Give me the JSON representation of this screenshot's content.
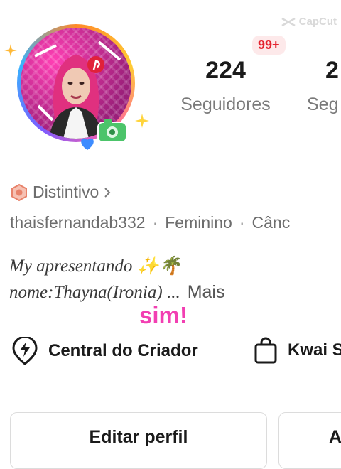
{
  "watermark": {
    "label": "CapCut"
  },
  "profile": {
    "notification_badge": "99+",
    "stats": [
      {
        "number": "224",
        "label": "Seguidores"
      },
      {
        "number": "2",
        "label": "Seg"
      }
    ],
    "badge_label": "Distintivo",
    "username": "thaisfernandab332",
    "gender": "Feminino",
    "extra": "Cânc",
    "separator": "·",
    "bio_line1": "My apresentando ✨🌴",
    "bio_line2": "nome:Thayna(Ironia) ...",
    "bio_more": "Mais",
    "overlay_text": "sim!"
  },
  "actions": {
    "creator_center": "Central do Criador",
    "kwai_shop": "Kwai S"
  },
  "buttons": {
    "edit_profile": "Editar perfil",
    "second": "A"
  },
  "colors": {
    "badge_red": "#e4232f",
    "overlay_pink": "#f23fb2",
    "muted_gray": "#7a7a7a"
  }
}
